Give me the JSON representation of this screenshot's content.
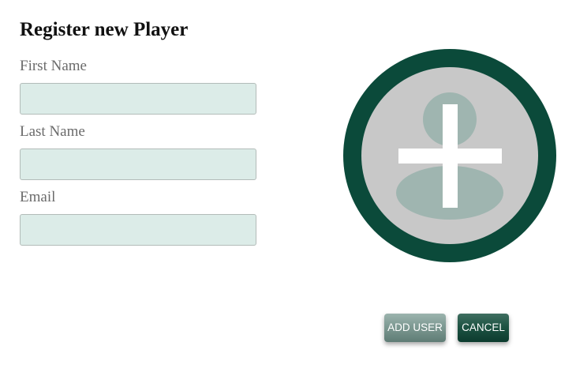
{
  "form": {
    "title": "Register new Player",
    "fields": [
      {
        "label": "First Name",
        "value": "",
        "placeholder": ""
      },
      {
        "label": "Last Name",
        "value": "",
        "placeholder": ""
      },
      {
        "label": "Email",
        "value": "",
        "placeholder": ""
      }
    ]
  },
  "avatar": {
    "icon": "add-user-avatar-icon",
    "ring_color": "#0b4a3a",
    "inner_color": "#c8c8c8",
    "silhouette_color": "#9fb5b0",
    "plus_color": "#ffffff"
  },
  "actions": {
    "add_label": "ADD USER",
    "cancel_label": "CANCEL"
  },
  "colors": {
    "input_bg": "#dcece8",
    "accent_dark": "#0b4a3a",
    "accent_light": "#7e9a93"
  }
}
